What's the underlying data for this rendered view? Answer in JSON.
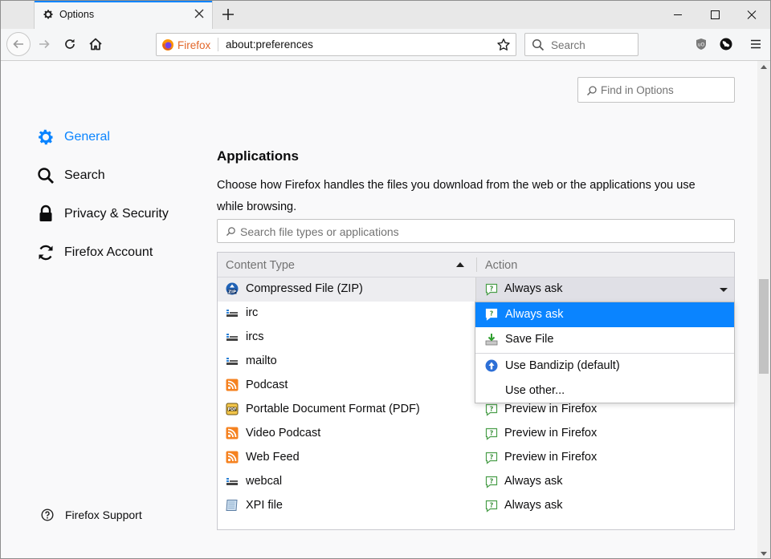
{
  "tab": {
    "title": "Options"
  },
  "urlbar": {
    "identity_label": "Firefox",
    "url": "about:preferences"
  },
  "searchbar": {
    "placeholder": "Search"
  },
  "find_in_options": {
    "placeholder": "Find in Options"
  },
  "sidebar": {
    "items": [
      {
        "label": "General",
        "icon": "gear-icon",
        "selected": true
      },
      {
        "label": "Search",
        "icon": "search-icon"
      },
      {
        "label": "Privacy & Security",
        "icon": "lock-icon"
      },
      {
        "label": "Firefox Account",
        "icon": "sync-icon"
      }
    ],
    "support_label": "Firefox Support"
  },
  "applications": {
    "heading": "Applications",
    "description": "Choose how Firefox handles the files you download from the web or the applications you use while browsing.",
    "filter_placeholder": "Search file types or applications",
    "columns": {
      "content_type": "Content Type",
      "action": "Action"
    },
    "rows": [
      {
        "type": "Compressed File (ZIP)",
        "action": "Always ask",
        "type_icon": "zip-icon",
        "action_icon": "ask-icon"
      },
      {
        "type": "irc",
        "action": "",
        "type_icon": "protocol-icon",
        "action_icon": ""
      },
      {
        "type": "ircs",
        "action": "",
        "type_icon": "protocol-icon",
        "action_icon": ""
      },
      {
        "type": "mailto",
        "action": "",
        "type_icon": "protocol-icon",
        "action_icon": ""
      },
      {
        "type": "Podcast",
        "action": "",
        "type_icon": "feed-icon",
        "action_icon": ""
      },
      {
        "type": "Portable Document Format (PDF)",
        "action": "Preview in Firefox",
        "type_icon": "pdf-icon",
        "action_icon": "ask-icon"
      },
      {
        "type": "Video Podcast",
        "action": "Preview in Firefox",
        "type_icon": "feed-icon",
        "action_icon": "ask-icon"
      },
      {
        "type": "Web Feed",
        "action": "Preview in Firefox",
        "type_icon": "feed-icon",
        "action_icon": "ask-icon"
      },
      {
        "type": "webcal",
        "action": "Always ask",
        "type_icon": "protocol-icon",
        "action_icon": "ask-icon"
      },
      {
        "type": "XPI file",
        "action": "Always ask",
        "type_icon": "xpi-icon",
        "action_icon": "ask-icon"
      }
    ],
    "dropdown": {
      "options": [
        {
          "label": "Always ask",
          "icon": "ask-icon",
          "highlighted": true
        },
        {
          "label": "Save File",
          "icon": "save-icon"
        },
        {
          "label": "Use Bandizip (default)",
          "icon": "bandizip-icon"
        },
        {
          "label": "Use other...",
          "icon": ""
        }
      ]
    }
  },
  "colors": {
    "accent": "#0a84ff",
    "firefox_label": "#e2672a"
  }
}
